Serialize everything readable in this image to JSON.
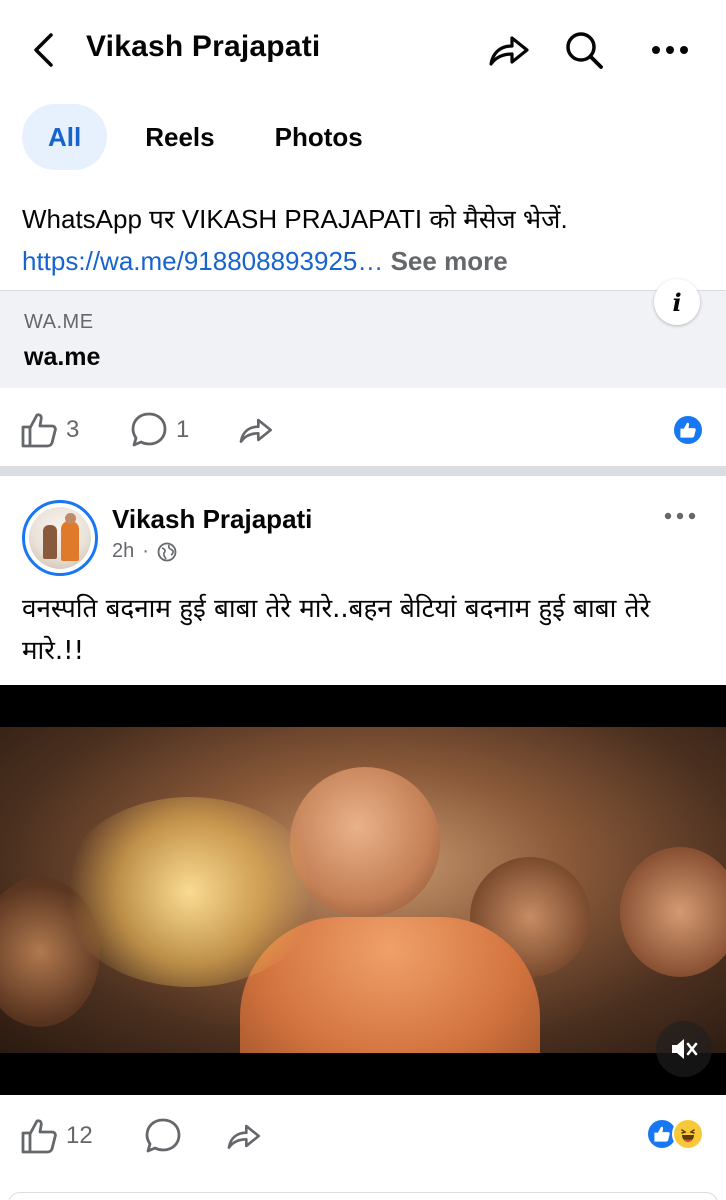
{
  "header": {
    "title": "Vikash Prajapati",
    "icons": {
      "back": "chevron-left-icon",
      "share": "share-arrow-icon",
      "search": "search-icon",
      "more": "more-dots-icon"
    }
  },
  "tabs": [
    {
      "label": "All",
      "active": true
    },
    {
      "label": "Reels",
      "active": false
    },
    {
      "label": "Photos",
      "active": false
    }
  ],
  "post1": {
    "text_prefix": "WhatsApp पर VIKASH PRAJAPATI को मैसेज भेजें. ",
    "link_text": "https://wa.me/918808893925…",
    "see_more": "See more",
    "link_card": {
      "domain": "WA.ME",
      "title": "wa.me",
      "info_icon": "i"
    },
    "likes": "3",
    "comments": "1"
  },
  "post2": {
    "author": "Vikash Prajapati",
    "time": "2h",
    "separator": "·",
    "privacy_icon": "globe-icon",
    "caption": "वनस्पति बदनाम हुई बाबा तेरे मारे..बहन बेटियां बदनाम हुई बाबा तेरे मारे.!!",
    "likes": "12",
    "reactions": [
      "like",
      "haha"
    ]
  },
  "colors": {
    "accent": "#1763cf",
    "like_blue": "#1877f2",
    "muted": "#65676b",
    "tab_active_bg": "#e7f0fd"
  }
}
